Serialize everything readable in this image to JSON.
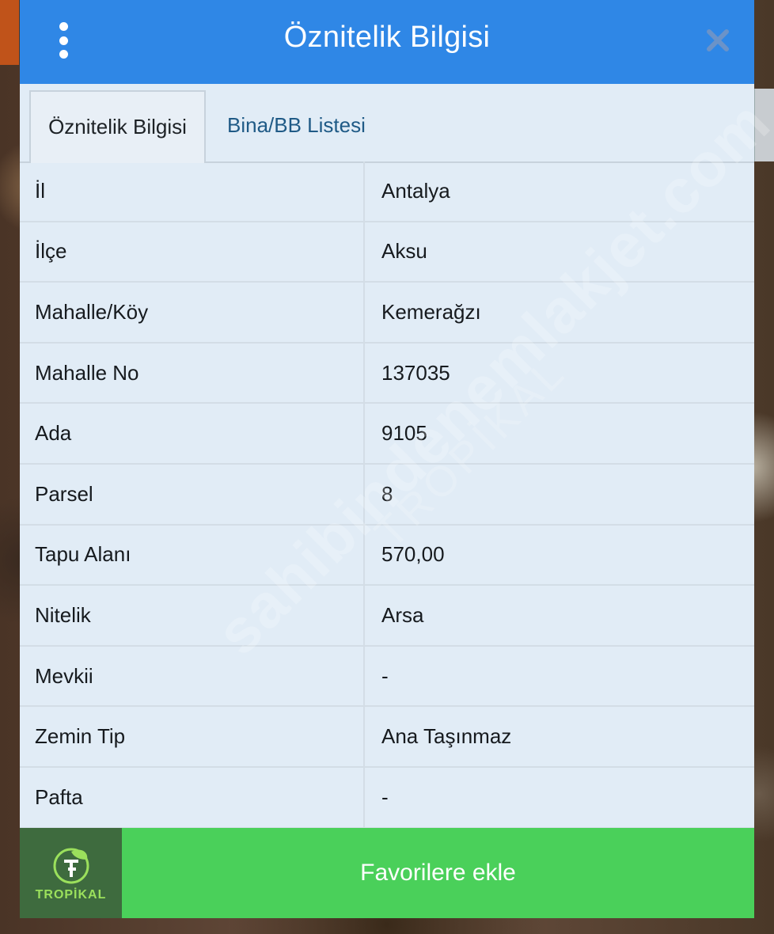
{
  "header": {
    "title": "Öznitelik Bilgisi",
    "menu_icon": "kebab-menu-icon",
    "close_icon": "close-icon"
  },
  "tabs": [
    {
      "label": "Öznitelik Bilgisi",
      "active": true
    },
    {
      "label": "Bina/BB Listesi",
      "active": false
    }
  ],
  "rows": [
    {
      "label": "İl",
      "value": "Antalya"
    },
    {
      "label": "İlçe",
      "value": "Aksu"
    },
    {
      "label": "Mahalle/Köy",
      "value": "Kemerağzı"
    },
    {
      "label": "Mahalle No",
      "value": "137035"
    },
    {
      "label": "Ada",
      "value": "9105"
    },
    {
      "label": "Parsel",
      "value": "8"
    },
    {
      "label": "Tapu Alanı",
      "value": "570,00"
    },
    {
      "label": "Nitelik",
      "value": "Arsa"
    },
    {
      "label": "Mevkii",
      "value": "-"
    },
    {
      "label": "Zemin Tip",
      "value": "Ana Taşınmaz"
    },
    {
      "label": "Pafta",
      "value": "-"
    }
  ],
  "watermark": {
    "line1": "sahibindenemlakjet.com",
    "line2": "TROPİKAL"
  },
  "footer": {
    "logo_text": "TROPİKAL",
    "favorite_label": "Favorilere ekle"
  },
  "colors": {
    "header": "#2f87e6",
    "favorite_button": "#4ad05a",
    "panel": "#e1ecf6"
  }
}
